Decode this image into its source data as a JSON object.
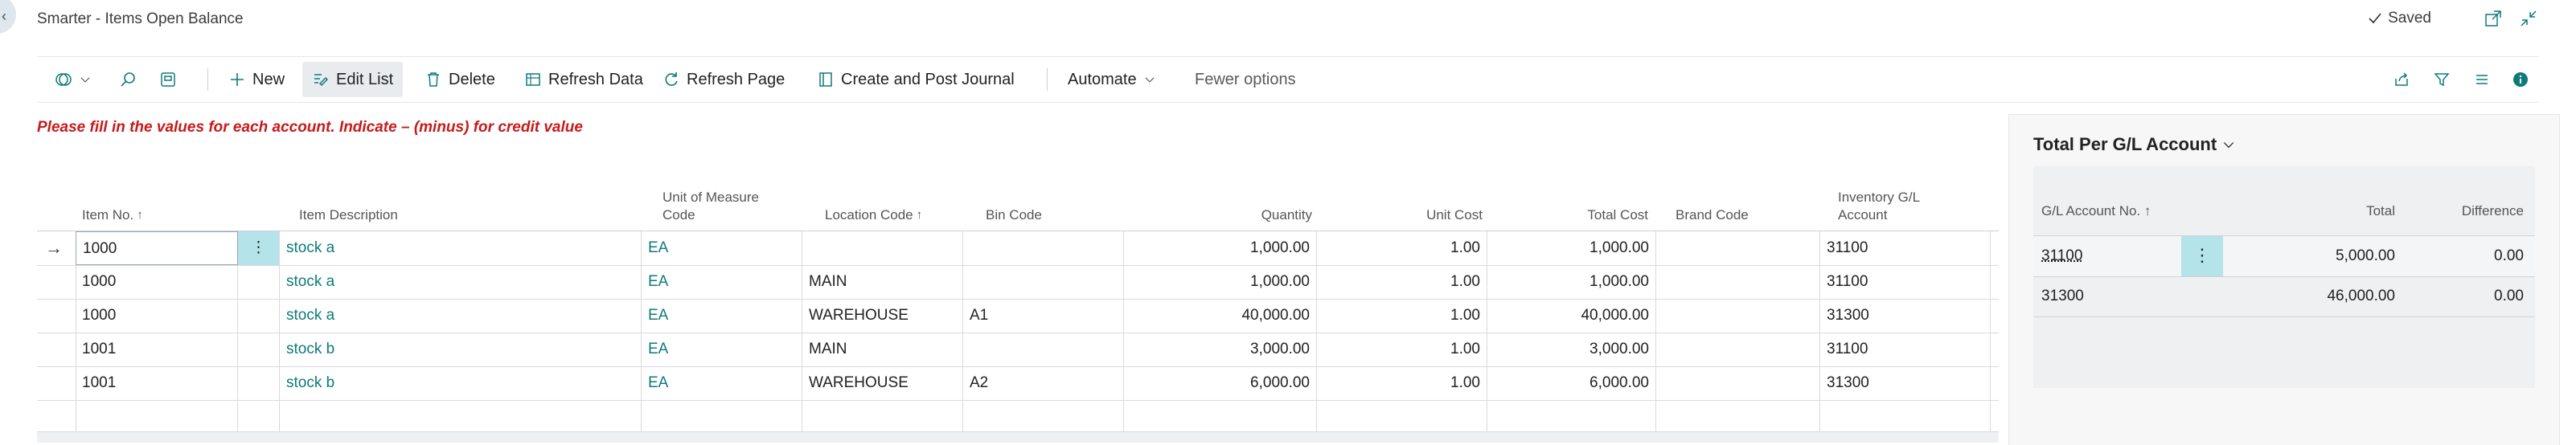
{
  "window": {
    "title": "Smarter - Items Open Balance",
    "saved_label": "Saved"
  },
  "actions": {
    "new": "New",
    "edit_list": "Edit List",
    "delete": "Delete",
    "refresh_data": "Refresh Data",
    "refresh_page": "Refresh Page",
    "create_post": "Create and Post Journal",
    "automate": "Automate",
    "fewer_options": "Fewer options"
  },
  "message": "Please fill in the values for each account. Indicate – (minus) for credit value",
  "grid": {
    "headers": {
      "item_no": "Item No.",
      "item_desc": "Item Description",
      "uom_line1": "Unit of Measure",
      "uom_line2": "Code",
      "location": "Location Code",
      "bin": "Bin Code",
      "quantity": "Quantity",
      "unit_cost": "Unit Cost",
      "total_cost": "Total Cost",
      "brand": "Brand Code",
      "inv_line1": "Inventory G/L",
      "inv_line2": "Account",
      "sort_arrow": "↑"
    },
    "rows": [
      {
        "item_no": "1000",
        "desc": "stock a",
        "uom": "EA",
        "location": "",
        "bin": "",
        "qty": "1,000.00",
        "unit_cost": "1.00",
        "total_cost": "1,000.00",
        "brand": "",
        "inv_gl": "31100"
      },
      {
        "item_no": "1000",
        "desc": "stock a",
        "uom": "EA",
        "location": "MAIN",
        "bin": "",
        "qty": "1,000.00",
        "unit_cost": "1.00",
        "total_cost": "1,000.00",
        "brand": "",
        "inv_gl": "31100"
      },
      {
        "item_no": "1000",
        "desc": "stock a",
        "uom": "EA",
        "location": "WAREHOUSE",
        "bin": "A1",
        "qty": "40,000.00",
        "unit_cost": "1.00",
        "total_cost": "40,000.00",
        "brand": "",
        "inv_gl": "31300"
      },
      {
        "item_no": "1001",
        "desc": "stock b",
        "uom": "EA",
        "location": "MAIN",
        "bin": "",
        "qty": "3,000.00",
        "unit_cost": "1.00",
        "total_cost": "3,000.00",
        "brand": "",
        "inv_gl": "31100"
      },
      {
        "item_no": "1001",
        "desc": "stock b",
        "uom": "EA",
        "location": "WAREHOUSE",
        "bin": "A2",
        "qty": "6,000.00",
        "unit_cost": "1.00",
        "total_cost": "6,000.00",
        "brand": "",
        "inv_gl": "31300"
      }
    ]
  },
  "factbox": {
    "title": "Total Per G/L Account",
    "headers": {
      "account": "G/L Account No.",
      "total": "Total",
      "difference": "Difference"
    },
    "rows": [
      {
        "account": "31100",
        "total": "5,000.00",
        "difference": "0.00"
      },
      {
        "account": "31300",
        "total": "46,000.00",
        "difference": "0.00"
      }
    ]
  },
  "icons": [
    "personalize-icon",
    "search-icon",
    "filter-pane-icon",
    "plus-icon",
    "edit-list-icon",
    "delete-icon",
    "refresh-data-icon",
    "refresh-page-icon",
    "journal-icon",
    "chevron-down-icon",
    "share-icon",
    "filter-icon",
    "list-view-icon",
    "info-icon",
    "checkmark-icon",
    "open-new-window-icon",
    "collapse-icon",
    "ellipsis-icon"
  ],
  "colors": {
    "accent": "#0e7a7a",
    "message": "#c71a1a",
    "selected_cell": "#b4e3ea"
  }
}
